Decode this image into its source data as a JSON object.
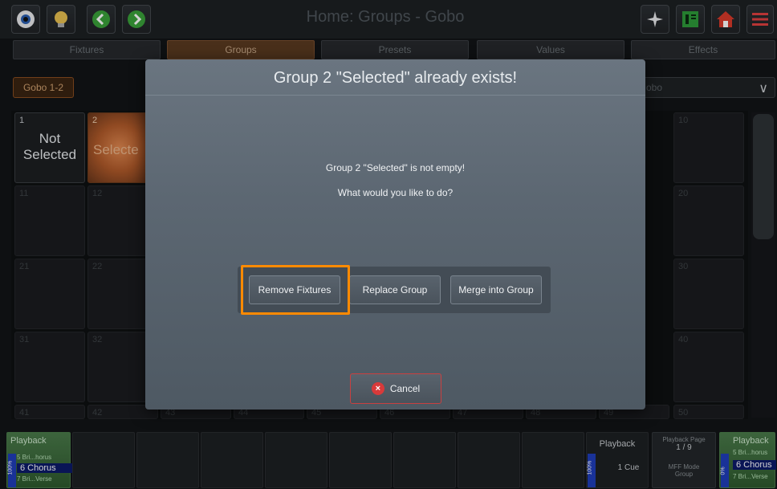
{
  "header": {
    "title": "Home: Groups - Gobo"
  },
  "tabs": [
    {
      "label": "Fixtures"
    },
    {
      "label": "Groups"
    },
    {
      "label": "Presets"
    },
    {
      "label": "Values"
    },
    {
      "label": "Effects"
    }
  ],
  "group_chip": "Gobo 1-2",
  "dropdown": {
    "value": "obo"
  },
  "grid": {
    "cells": [
      {
        "num": "1",
        "label_line1": "Not",
        "label_line2": "Selected"
      },
      {
        "num": "2",
        "label": "Selecte"
      },
      {
        "num": "10"
      },
      {
        "num": "11"
      },
      {
        "num": "12"
      },
      {
        "num": "20"
      },
      {
        "num": "21"
      },
      {
        "num": "22"
      },
      {
        "num": "30"
      },
      {
        "num": "31"
      },
      {
        "num": "32"
      },
      {
        "num": "40"
      },
      {
        "num": "41"
      },
      {
        "num": "42"
      },
      {
        "num": "43"
      },
      {
        "num": "44"
      },
      {
        "num": "45"
      },
      {
        "num": "46"
      },
      {
        "num": "47"
      },
      {
        "num": "48"
      },
      {
        "num": "49"
      },
      {
        "num": "50"
      }
    ]
  },
  "playback_left": {
    "title": "Playback",
    "line1": "5 Bri...horus",
    "current": "6 Chorus",
    "line3": "7 Bri...Verse",
    "level": "100%"
  },
  "playback_mid": {
    "title": "Playback",
    "cue": "1 Cue",
    "level": "100%"
  },
  "playback_page": {
    "label": "Playback Page",
    "value": "1 / 9",
    "mode_label": "MFF Mode",
    "mode_value": "Group"
  },
  "playback_right": {
    "title": "Playback",
    "line1": "5 Bri...horus",
    "current": "6 Chorus",
    "line3": "7 Bri...Verse",
    "level": "0%"
  },
  "dialog": {
    "title": "Group 2 \"Selected\" already exists!",
    "message1": "Group 2 \"Selected\" is not empty!",
    "message2": "What would you like to do?",
    "remove_label": "Remove Fixtures",
    "replace_label": "Replace Group",
    "merge_label": "Merge into Group",
    "cancel_label": "Cancel"
  },
  "colors": {
    "accent": "#ff8a00",
    "selected_group": "#b05a2a",
    "playback_green": "#4a7a4a"
  }
}
